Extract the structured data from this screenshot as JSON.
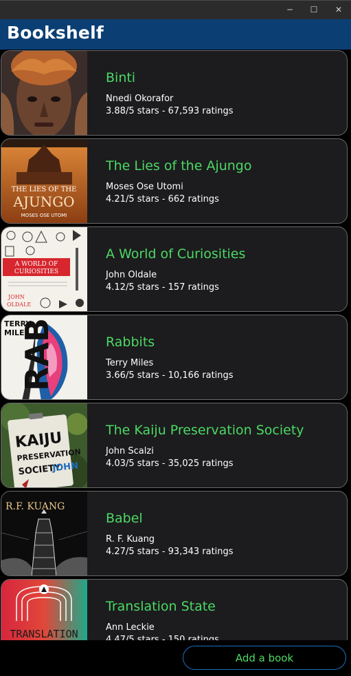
{
  "window": {
    "minimize_glyph": "─",
    "maximize_glyph": "☐",
    "close_glyph": "✕"
  },
  "header": {
    "title": "Bookshelf"
  },
  "books": [
    {
      "title": "Binti",
      "author": "Nnedi Okorafor",
      "stats": "3.88/5 stars - 67,593 ratings"
    },
    {
      "title": "The Lies of the Ajungo",
      "author": "Moses Ose Utomi",
      "stats": "4.21/5 stars - 662 ratings",
      "cover_title_top": "THE LIES OF THE",
      "cover_title": "AJUNGO",
      "cover_author": "MOSES OSE UTOMI"
    },
    {
      "title": "A World of Curiosities",
      "author": "John Oldale",
      "stats": "4.12/5 stars - 157 ratings",
      "cover_title": "A WORLD OF",
      "cover_subtitle": "CURIOSITIES",
      "cover_author_1": "JOHN",
      "cover_author_2": "OLDALE"
    },
    {
      "title": "Rabbits",
      "author": "Terry Miles",
      "stats": "3.66/5 stars - 10,166 ratings",
      "cover_author_1": "TERRY",
      "cover_author_2": "MILES",
      "cover_title": "RABB"
    },
    {
      "title": "The Kaiju Preservation Society",
      "author": "John Scalzi",
      "stats": "4.03/5 stars - 35,025 ratings",
      "cover_line_1": "KAIJU",
      "cover_line_2": "PRESERVATION",
      "cover_line_3": "SOCIETY",
      "cover_author": "JOHN"
    },
    {
      "title": "Babel",
      "author": "R. F. Kuang",
      "stats": "4.27/5 stars - 93,343 ratings",
      "cover_author": "R.F. KUANG"
    },
    {
      "title": "Translation State",
      "author": "Ann Leckie",
      "stats": "4.47/5 stars - 150 ratings",
      "cover_title": "TRANSLATION"
    }
  ],
  "footer": {
    "add_button_label": "Add a book"
  },
  "colors": {
    "accent_green": "#4cd964",
    "header_blue": "#0b3f74",
    "card_background": "#1c1c1e",
    "button_border": "#1e6fc0"
  }
}
